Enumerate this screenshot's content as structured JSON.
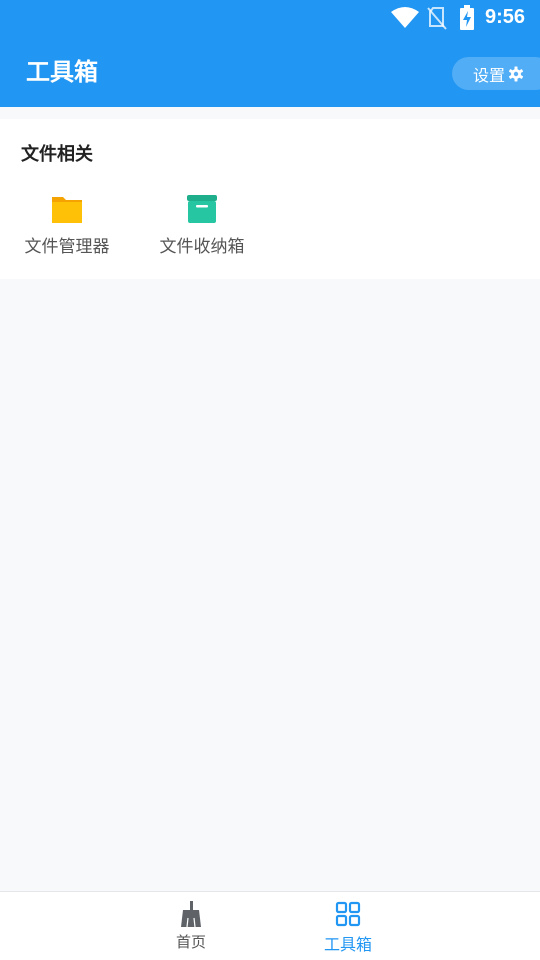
{
  "status_bar": {
    "time": "9:56"
  },
  "app_bar": {
    "title": "工具箱",
    "settings_label": "设置"
  },
  "section": {
    "title": "文件相关",
    "tools": [
      {
        "label": "文件管理器",
        "icon": "folder-icon",
        "color": "#FFB300"
      },
      {
        "label": "文件收纳箱",
        "icon": "archive-box-icon",
        "color": "#26C6A2"
      }
    ]
  },
  "bottom_nav": {
    "items": [
      {
        "label": "首页",
        "icon": "broom-icon",
        "active": false
      },
      {
        "label": "工具箱",
        "icon": "grid-icon",
        "active": true
      }
    ]
  },
  "colors": {
    "primary": "#2196F3",
    "background": "#F8F9FB"
  }
}
